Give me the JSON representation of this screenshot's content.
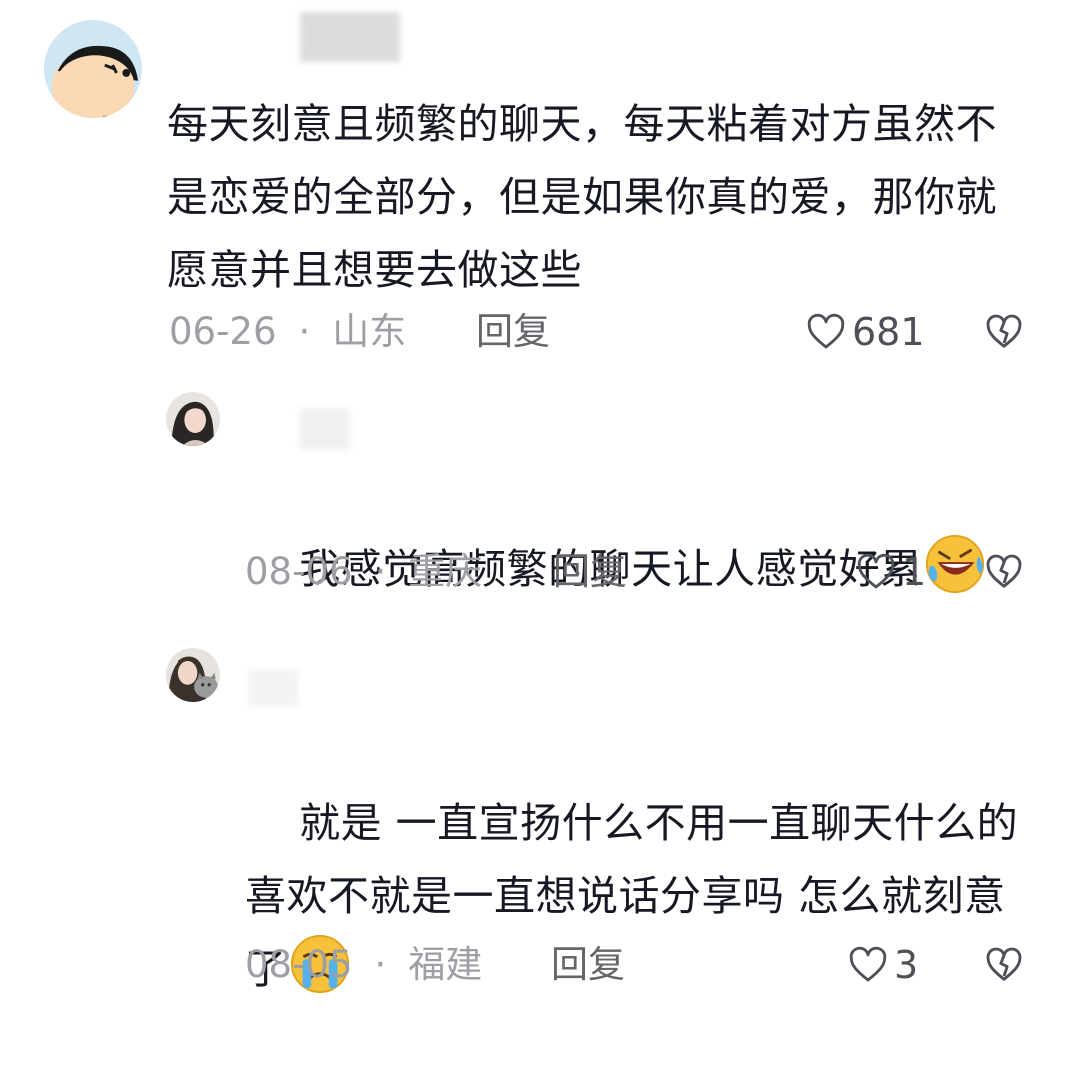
{
  "comments": [
    {
      "text": "每天刻意且频繁的聊天，每天粘着对方虽然不是恋爱的全部分，但是如果你真的爱，那你就愿意并且想要去做这些",
      "date": "06-26",
      "location": "山东",
      "reply_label": "回复",
      "likes": "681",
      "avatar": "cartoon-boy-avatar"
    },
    {
      "text": "我感觉高频繁的聊天让人感觉好累",
      "emoji": "rolling-laughing-emoji",
      "date": "08-06",
      "location": "重庆",
      "reply_label": "回复",
      "likes": "1",
      "avatar": "woman-photo-avatar"
    },
    {
      "text": "就是 一直宣扬什么不用一直聊天什么的 喜欢不就是一直想说话分享吗 怎么就刻意了",
      "emoji": "crying-emoji",
      "date": "08-05",
      "location": "福建",
      "reply_label": "回复",
      "likes": "3",
      "avatar": "woman-with-cat-avatar"
    }
  ],
  "colors": {
    "text": "#161823",
    "meta": "#9d9fa4",
    "reply": "#64666b"
  }
}
